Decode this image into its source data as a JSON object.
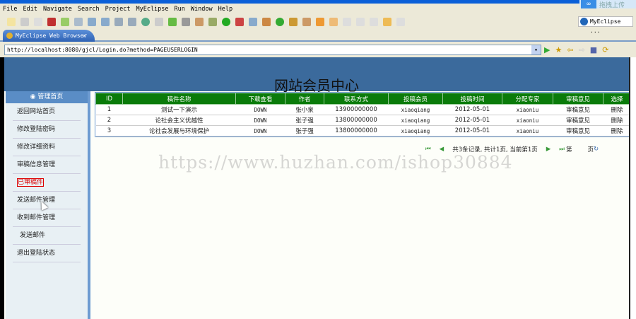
{
  "titlebar": {
    "upload_label": "拖拽上传"
  },
  "menu": [
    "File",
    "Edit",
    "Navigate",
    "Search",
    "Project",
    "MyEclipse",
    "Run",
    "Window",
    "Help"
  ],
  "perspective": "MyEclipse ...",
  "tab": {
    "label": "MyEclipse Web Browser",
    "close": "✕"
  },
  "address": "http://localhost:8080/gjcl/Login.do?method=PAGEUSERLOGIN",
  "page": {
    "title": "网站会员中心"
  },
  "sidebar": {
    "head": "管理首页",
    "items": [
      "返回网站首页",
      "修改登陆密码",
      "修改详细资料",
      "审稿信息管理",
      "已审稿件",
      "发送邮件管理",
      "收到邮件管理",
      "发送邮件",
      "退出登陆状态"
    ]
  },
  "table": {
    "headers": [
      "ID",
      "稿件名称",
      "下载查看",
      "作者",
      "联系方式",
      "投稿会员",
      "投稿时间",
      "分配专家",
      "审稿意见",
      "选择"
    ],
    "rows": [
      [
        "1",
        "测试一下演示",
        "DOWN",
        "张小泉",
        "13900000000",
        "xiaoqiang",
        "2012-05-01",
        "xiaoniu",
        "审稿意见",
        "删除"
      ],
      [
        "2",
        "论社会主义优越性",
        "DOWN",
        "张子强",
        "13800000000",
        "xiaoqiang",
        "2012-05-01",
        "xiaoniu",
        "审稿意见",
        "删除"
      ],
      [
        "3",
        "论社会发展与环境保护",
        "DOWN",
        "张子强",
        "13800000000",
        "xiaoqiang",
        "2012-05-01",
        "xiaoniu",
        "审稿意见",
        "删除"
      ]
    ]
  },
  "pager": {
    "first": "⏮",
    "prev": "◀",
    "info": "共3条记录, 共计1页, 当前第1页",
    "next": "▶",
    "last": "⏭",
    "page_prefix": "第",
    "page_suffix": "页",
    "go": "↻"
  },
  "watermark": "https://www.huzhan.com/ishop30884"
}
